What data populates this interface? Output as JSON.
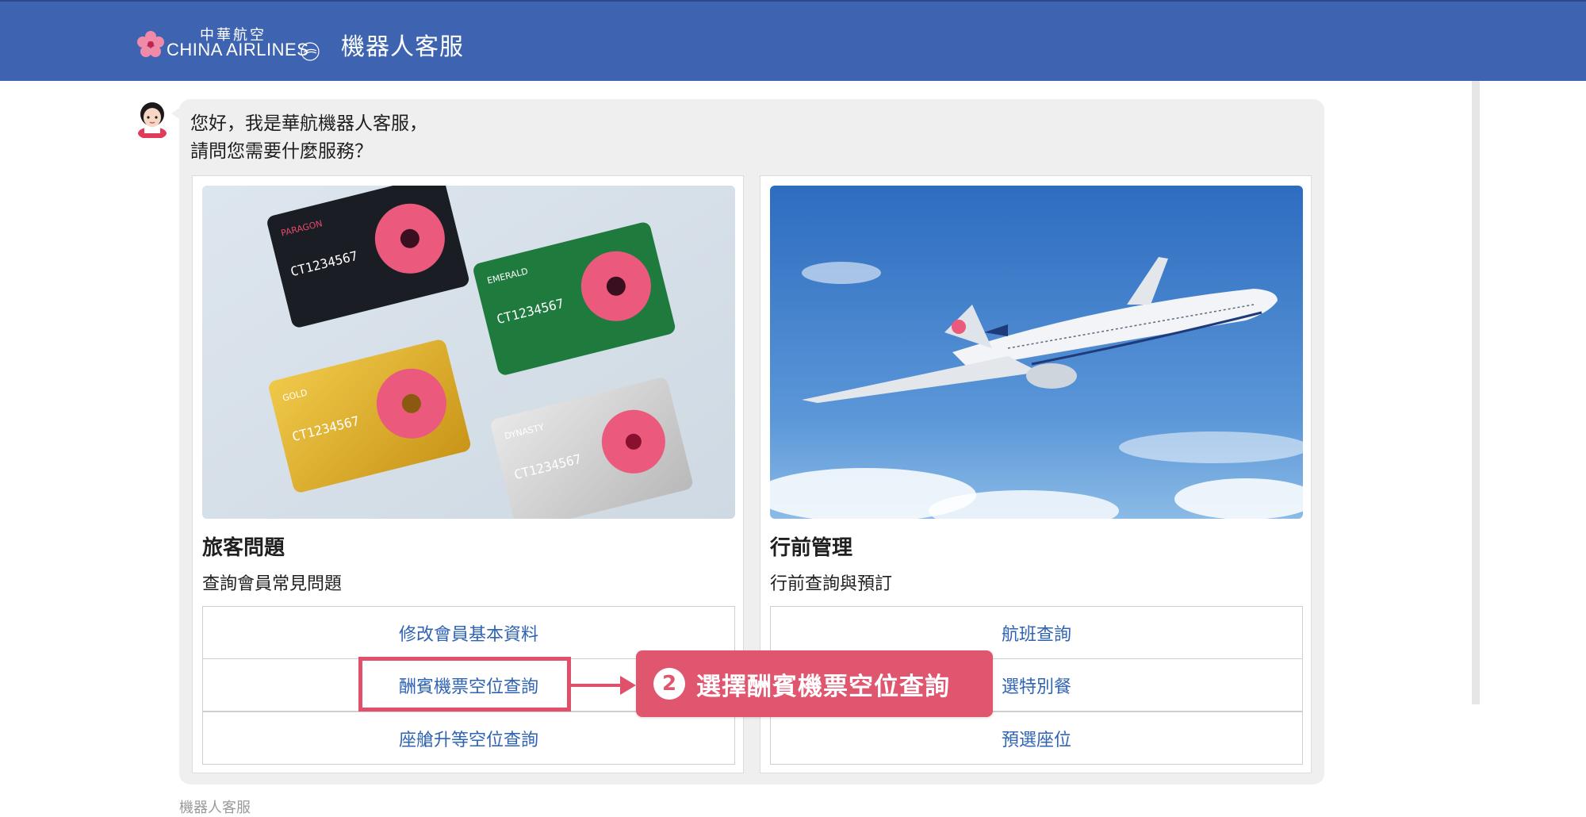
{
  "header": {
    "logo_cn": "中華航空",
    "logo_en": "CHINA AIRLINES",
    "title": "機器人客服"
  },
  "chat": {
    "greeting_line1": "您好，我是華航機器人客服，",
    "greeting_line2": "請問您需要什麼服務？"
  },
  "cards": [
    {
      "title": "旅客問題",
      "subtitle": "查詢會員常見問題",
      "card_labels": [
        "PARAGON",
        "EMERALD",
        "GOLD",
        "DYNASTY"
      ],
      "card_number": "CT1234567",
      "buttons": [
        "修改會員基本資料",
        "酬賓機票空位查詢",
        "座艙升等空位查詢"
      ]
    },
    {
      "title": "行前管理",
      "subtitle": "行前查詢與預訂",
      "buttons": [
        "航班查詢",
        "選特別餐",
        "預選座位"
      ]
    }
  ],
  "callout": {
    "step": "2",
    "text": "選擇酬賓機票空位查詢"
  },
  "footer": {
    "label": "機器人客服"
  },
  "colors": {
    "header": "#3d63b1",
    "link": "#2f63b3",
    "highlight": "#e0566f"
  }
}
